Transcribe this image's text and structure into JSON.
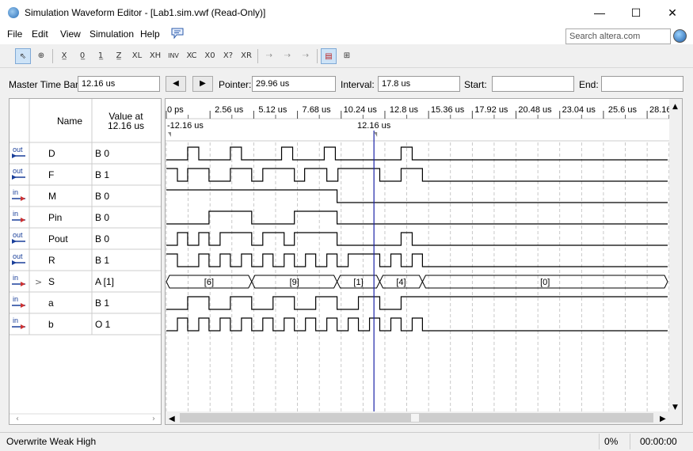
{
  "window": {
    "title": "Simulation Waveform Editor - [Lab1.sim.vwf (Read-Only)]",
    "minimize_glyph": "—",
    "maximize_glyph": "☐",
    "close_glyph": "✕"
  },
  "menu": [
    "File",
    "Edit",
    "View",
    "Simulation",
    "Help"
  ],
  "search": {
    "placeholder": "Search altera.com"
  },
  "toolbar": [
    "⇖",
    "⊕",
    "X̲",
    "0̲",
    "1̲",
    "Z̲",
    "XL",
    "XH",
    "INV",
    "XC",
    "X0",
    "X?",
    "XR",
    "⇢",
    "⇢",
    "⇢",
    "▤",
    "⊞"
  ],
  "timebar": {
    "master_label": "Master Time Bar:",
    "master_value": "12.16 us",
    "prev_glyph": "◀",
    "next_glyph": "▶",
    "pointer_label": "Pointer:",
    "pointer_value": "29.96 us",
    "interval_label": "Interval:",
    "interval_value": "17.8 us",
    "start_label": "Start:",
    "start_value": "",
    "end_label": "End:",
    "end_value": ""
  },
  "table": {
    "name_header": "Name",
    "value_header_line1": "Value at",
    "value_header_line2": "12.16 us"
  },
  "signals": [
    {
      "dir": "out",
      "name": "D",
      "value": "B 0"
    },
    {
      "dir": "out",
      "name": "F",
      "value": "B 1"
    },
    {
      "dir": "in",
      "name": "M",
      "value": "B 0"
    },
    {
      "dir": "in",
      "name": "Pin",
      "value": "B 0"
    },
    {
      "dir": "out",
      "name": "Pout",
      "value": "B 0"
    },
    {
      "dir": "out",
      "name": "R",
      "value": "B 1"
    },
    {
      "dir": "in",
      "name": "S",
      "value": "A [1]",
      "expand": ">"
    },
    {
      "dir": "in",
      "name": "a",
      "value": "B 1"
    },
    {
      "dir": "in",
      "name": "b",
      "value": "O 1"
    }
  ],
  "timeline": {
    "ticks": [
      "0 ps",
      "2.56 us",
      "5.12 us",
      "7.68 us",
      "10.24 us",
      "12.8 us",
      "15.36 us",
      "17.92 us",
      "20.48 us",
      "23.04 us",
      "25.6 us",
      "28.16 us"
    ],
    "left_marker": "-12.16 us",
    "cursor_label": "12.16 us",
    "range_us": [
      0,
      29.5
    ],
    "cursor_us": 12.16
  },
  "waveforms": {
    "D": [
      [
        0,
        0
      ],
      [
        1.25,
        1
      ],
      [
        1.9,
        0
      ],
      [
        3.75,
        1
      ],
      [
        4.4,
        0
      ],
      [
        6.75,
        1
      ],
      [
        7.4,
        0
      ],
      [
        9.25,
        1
      ],
      [
        9.9,
        0
      ],
      [
        13.75,
        1
      ],
      [
        14.4,
        0
      ],
      [
        30,
        0
      ]
    ],
    "F": [
      [
        0,
        1
      ],
      [
        0.65,
        0
      ],
      [
        1.25,
        1
      ],
      [
        2.5,
        0
      ],
      [
        3.75,
        1
      ],
      [
        5.0,
        0
      ],
      [
        5.65,
        1
      ],
      [
        7.5,
        0
      ],
      [
        8.1,
        1
      ],
      [
        9.4,
        0
      ],
      [
        10.05,
        1
      ],
      [
        12.5,
        0
      ],
      [
        13.75,
        1
      ],
      [
        15.0,
        0
      ],
      [
        30,
        0
      ]
    ],
    "M": [
      [
        0,
        1
      ],
      [
        10.0,
        0
      ],
      [
        30,
        0
      ]
    ],
    "Pin": [
      [
        0,
        0
      ],
      [
        2.5,
        1
      ],
      [
        5.0,
        0
      ],
      [
        7.5,
        1
      ],
      [
        10.0,
        0
      ],
      [
        30,
        0
      ]
    ],
    "Pout": [
      [
        0,
        0
      ],
      [
        0.65,
        1
      ],
      [
        1.25,
        0
      ],
      [
        1.9,
        1
      ],
      [
        2.5,
        0
      ],
      [
        3.15,
        1
      ],
      [
        5.0,
        0
      ],
      [
        5.65,
        1
      ],
      [
        6.9,
        0
      ],
      [
        7.5,
        1
      ],
      [
        10.0,
        0
      ],
      [
        13.75,
        1
      ],
      [
        14.4,
        0
      ],
      [
        30,
        0
      ]
    ],
    "R": [
      [
        0,
        1
      ],
      [
        0.65,
        0
      ],
      [
        1.9,
        1
      ],
      [
        2.5,
        0
      ],
      [
        3.15,
        1
      ],
      [
        3.75,
        0
      ],
      [
        4.4,
        1
      ],
      [
        5.0,
        0
      ],
      [
        5.65,
        1
      ],
      [
        6.25,
        0
      ],
      [
        6.9,
        1
      ],
      [
        7.5,
        0
      ],
      [
        8.15,
        1
      ],
      [
        8.75,
        0
      ],
      [
        9.4,
        1
      ],
      [
        10.0,
        0
      ],
      [
        10.65,
        1
      ],
      [
        12.5,
        0
      ],
      [
        13.15,
        1
      ],
      [
        13.75,
        0
      ],
      [
        14.4,
        1
      ],
      [
        15.0,
        0
      ],
      [
        30,
        0
      ]
    ],
    "a": [
      [
        0,
        0
      ],
      [
        1.25,
        1
      ],
      [
        2.5,
        0
      ],
      [
        3.75,
        1
      ],
      [
        5.0,
        0
      ],
      [
        6.25,
        1
      ],
      [
        7.5,
        0
      ],
      [
        8.75,
        1
      ],
      [
        10.0,
        0
      ],
      [
        11.25,
        1
      ],
      [
        12.5,
        0
      ],
      [
        13.75,
        1
      ],
      [
        15.0,
        1
      ],
      [
        30,
        1
      ]
    ],
    "b": [
      [
        0,
        0
      ],
      [
        0.65,
        1
      ],
      [
        1.25,
        0
      ],
      [
        1.9,
        1
      ],
      [
        2.5,
        0
      ],
      [
        3.15,
        1
      ],
      [
        3.75,
        0
      ],
      [
        4.4,
        1
      ],
      [
        5.0,
        0
      ],
      [
        5.65,
        1
      ],
      [
        6.25,
        0
      ],
      [
        6.9,
        1
      ],
      [
        7.5,
        0
      ],
      [
        8.15,
        1
      ],
      [
        8.75,
        0
      ],
      [
        9.4,
        1
      ],
      [
        10.0,
        0
      ],
      [
        10.65,
        1
      ],
      [
        11.25,
        0
      ],
      [
        11.9,
        1
      ],
      [
        12.5,
        0
      ],
      [
        13.15,
        1
      ],
      [
        13.75,
        0
      ],
      [
        14.4,
        1
      ],
      [
        15.0,
        0
      ],
      [
        30,
        0
      ]
    ]
  },
  "bus_S": [
    {
      "start": 0,
      "end": 5.0,
      "label": "[6]"
    },
    {
      "start": 5.0,
      "end": 10.0,
      "label": "[9]"
    },
    {
      "start": 10.0,
      "end": 12.5,
      "label": "[1]"
    },
    {
      "start": 12.5,
      "end": 15.0,
      "label": "[4]"
    },
    {
      "start": 15.0,
      "end": 29.5,
      "label": "[0]"
    }
  ],
  "status": {
    "mode": "Overwrite Weak High",
    "progress": "0%",
    "time": "00:00:00"
  }
}
